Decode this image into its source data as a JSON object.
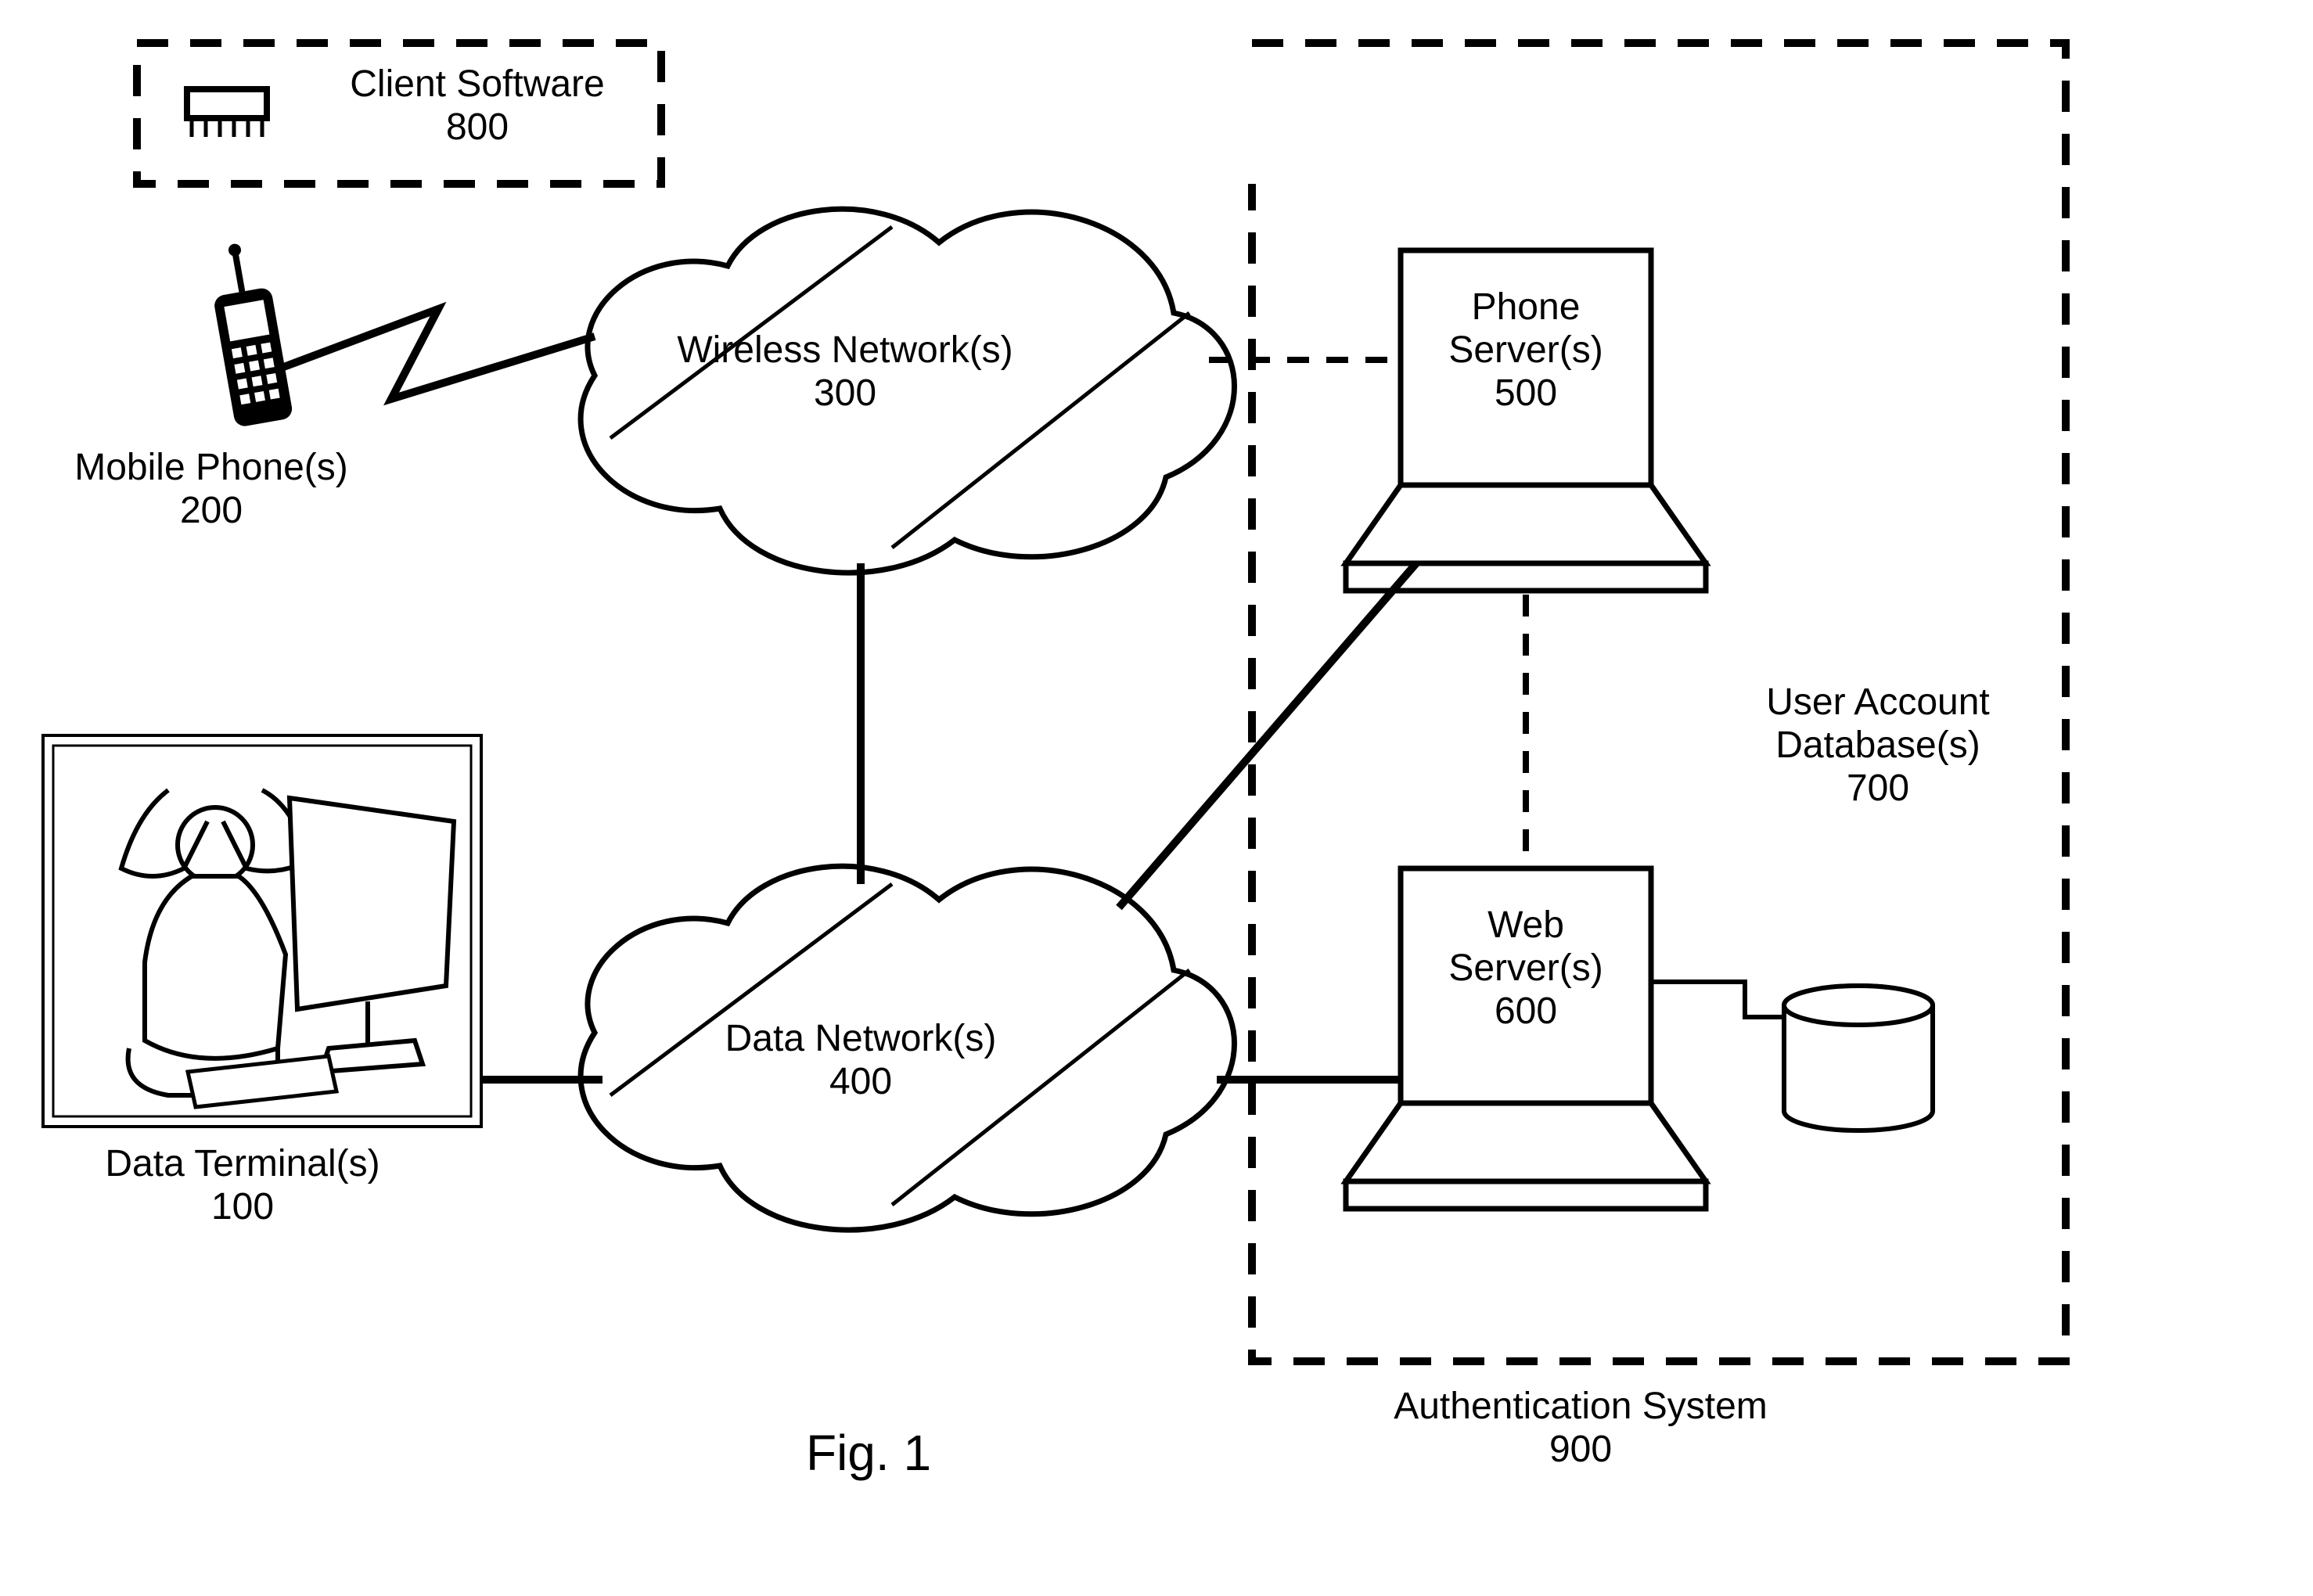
{
  "figure_label": "Fig. 1",
  "client_software": {
    "title": "Client Software",
    "ref": "800"
  },
  "mobile_phone": {
    "title": "Mobile Phone(s)",
    "ref": "200"
  },
  "wireless_network": {
    "title": "Wireless Network(s)",
    "ref": "300"
  },
  "data_terminal": {
    "title": "Data Terminal(s)",
    "ref": "100"
  },
  "data_network": {
    "title": "Data Network(s)",
    "ref": "400"
  },
  "phone_server": {
    "title": "Phone",
    "subtitle": "Server(s)",
    "ref": "500"
  },
  "web_server": {
    "title": "Web",
    "subtitle": "Server(s)",
    "ref": "600"
  },
  "user_db": {
    "title": "User Account",
    "subtitle": "Database(s)",
    "ref": "700"
  },
  "auth_system": {
    "title": "Authentication System",
    "ref": "900"
  }
}
